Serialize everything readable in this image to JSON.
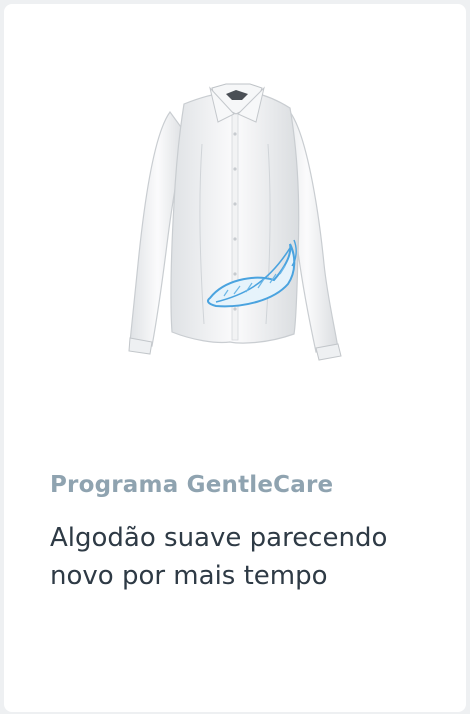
{
  "card": {
    "image_icon": "white-shirt-with-feather-illustration",
    "eyebrow": "Programa GentleCare",
    "headline": "Algodão suave parecendo novo por mais tempo"
  },
  "colors": {
    "background": "#eef0f2",
    "card": "#ffffff",
    "eyebrow": "#8fa3b0",
    "headline": "#2e3a45",
    "feather": "#4aa3df"
  }
}
